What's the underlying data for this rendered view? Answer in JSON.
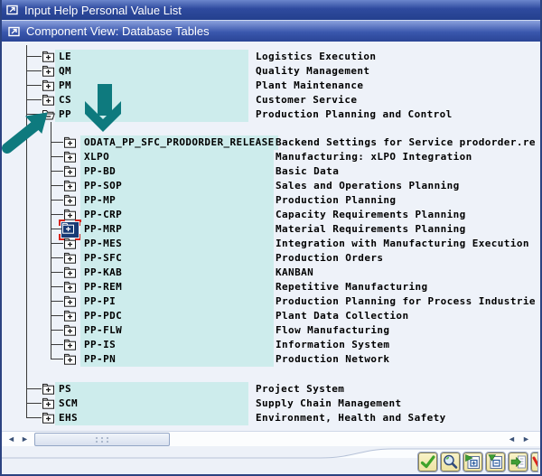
{
  "window": {
    "title": "Input Help Personal Value List",
    "icon": "dialog-window-icon"
  },
  "dialog": {
    "title": "Component View: Database Tables",
    "icon": "dialog-window-icon"
  },
  "colors": {
    "titlebar_blue": "#2b4699",
    "highlight_cell": "#cdecec",
    "content_bg": "#eef2f9",
    "annotation_teal": "#0e7a7e",
    "selected_icon_bg": "#173a75",
    "selection_red": "#d9251d",
    "button_bg": "#f3ecb0"
  },
  "tree": {
    "nodes": [
      {
        "label": "LE",
        "desc": "Logistics Execution",
        "state": "collapsed"
      },
      {
        "label": "QM",
        "desc": "Quality Management",
        "state": "collapsed"
      },
      {
        "label": "PM",
        "desc": "Plant Maintenance",
        "state": "collapsed"
      },
      {
        "label": "CS",
        "desc": "Customer Service",
        "state": "collapsed"
      },
      {
        "label": "PP",
        "desc": "Production Planning and Control",
        "state": "expanded",
        "children": [
          {
            "label": "ODATA_PP_SFC_PRODORDER_RELEASE",
            "desc": "Backend Settings for Service prodorder.re",
            "state": "collapsed"
          },
          {
            "label": "XLPO",
            "desc": "Manufacturing: xLPO Integration",
            "state": "collapsed"
          },
          {
            "label": "PP-BD",
            "desc": "Basic Data",
            "state": "collapsed"
          },
          {
            "label": "PP-SOP",
            "desc": "Sales and Operations Planning",
            "state": "collapsed"
          },
          {
            "label": "PP-MP",
            "desc": "Production Planning",
            "state": "collapsed"
          },
          {
            "label": "PP-CRP",
            "desc": "Capacity Requirements Planning",
            "state": "collapsed"
          },
          {
            "label": "PP-MRP",
            "desc": "Material Requirements Planning",
            "state": "collapsed",
            "selected": true
          },
          {
            "label": "PP-MES",
            "desc": "Integration with Manufacturing Execution",
            "state": "collapsed"
          },
          {
            "label": "PP-SFC",
            "desc": "Production Orders",
            "state": "collapsed"
          },
          {
            "label": "PP-KAB",
            "desc": "KANBAN",
            "state": "collapsed"
          },
          {
            "label": "PP-REM",
            "desc": "Repetitive Manufacturing",
            "state": "collapsed"
          },
          {
            "label": "PP-PI",
            "desc": "Production Planning for Process Industrie",
            "state": "collapsed"
          },
          {
            "label": "PP-PDC",
            "desc": "Plant Data Collection",
            "state": "collapsed"
          },
          {
            "label": "PP-FLW",
            "desc": "Flow Manufacturing",
            "state": "collapsed"
          },
          {
            "label": "PP-IS",
            "desc": "Information System",
            "state": "collapsed"
          },
          {
            "label": "PP-PN",
            "desc": "Production Network",
            "state": "collapsed"
          }
        ]
      },
      {
        "label": "PS",
        "desc": "Project System",
        "state": "collapsed"
      },
      {
        "label": "SCM",
        "desc": "Supply Chain Management",
        "state": "collapsed"
      },
      {
        "label": "EHS",
        "desc": "Environment, Health and Safety",
        "state": "collapsed"
      }
    ]
  },
  "toolbar": {
    "buttons": [
      {
        "name": "continue-button",
        "icon": "green-check-icon"
      },
      {
        "name": "find-button",
        "icon": "magnifier-icon"
      },
      {
        "name": "expand-subtree-button",
        "icon": "expand-node-icon"
      },
      {
        "name": "collapse-subtree-button",
        "icon": "collapse-node-icon"
      },
      {
        "name": "transfer-button",
        "icon": "transfer-arrow-icon"
      },
      {
        "name": "cancel-button-partial",
        "icon": "red-x-icon-partial"
      }
    ]
  },
  "scrollbar": {
    "orientation": "horizontal",
    "left_arrows": [
      "◄",
      "►"
    ],
    "right_arrows": [
      "◄",
      "►"
    ]
  }
}
